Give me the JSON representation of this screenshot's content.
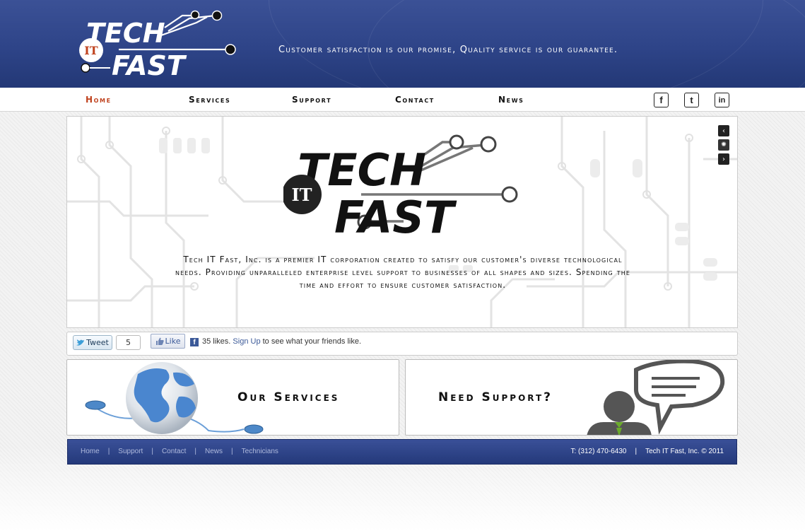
{
  "header": {
    "logo": {
      "word1": "TECH",
      "badge": "IT",
      "word2": "FAST"
    },
    "tagline": "Customer satisfaction is our promise, Quality service is our guarantee."
  },
  "nav": {
    "items": [
      {
        "label": "Home",
        "active": true
      },
      {
        "label": "Services"
      },
      {
        "label": "Support"
      },
      {
        "label": "Contact"
      },
      {
        "label": "News"
      }
    ],
    "social": {
      "facebook": "f",
      "twitter": "t",
      "linkedin": "in"
    }
  },
  "hero": {
    "logo": {
      "word1": "TECH",
      "badge": "IT",
      "word2": "FAST"
    },
    "description": "Tech IT Fast, Inc. is a premier IT corporation created to satisfy our customer's diverse technological needs. Providing unparalleled enterprise level support to businesses of all shapes and sizes. Spending the time and effort to ensure customer satisfaction.",
    "slider": {
      "prev": "‹",
      "loading": "✺",
      "next": "›"
    }
  },
  "social_bar": {
    "tweet_label": "Tweet",
    "tweet_count": "5",
    "like_label": "Like",
    "fb_icon": "f",
    "likes_count_text": "35 likes.",
    "signup_link": "Sign Up",
    "signup_suffix": "to see what your friends like."
  },
  "promos": {
    "services_title": "Our Services",
    "support_title": "Need Support?"
  },
  "footer": {
    "links": [
      "Home",
      "Support",
      "Contact",
      "News",
      "Technicians"
    ],
    "phone": "T: (312) 470-6430",
    "copyright": "Tech IT Fast, Inc. © 2011"
  },
  "colors": {
    "header_blue": "#2e4488",
    "accent_orange": "#c0431f",
    "facebook_blue": "#3b5998"
  }
}
